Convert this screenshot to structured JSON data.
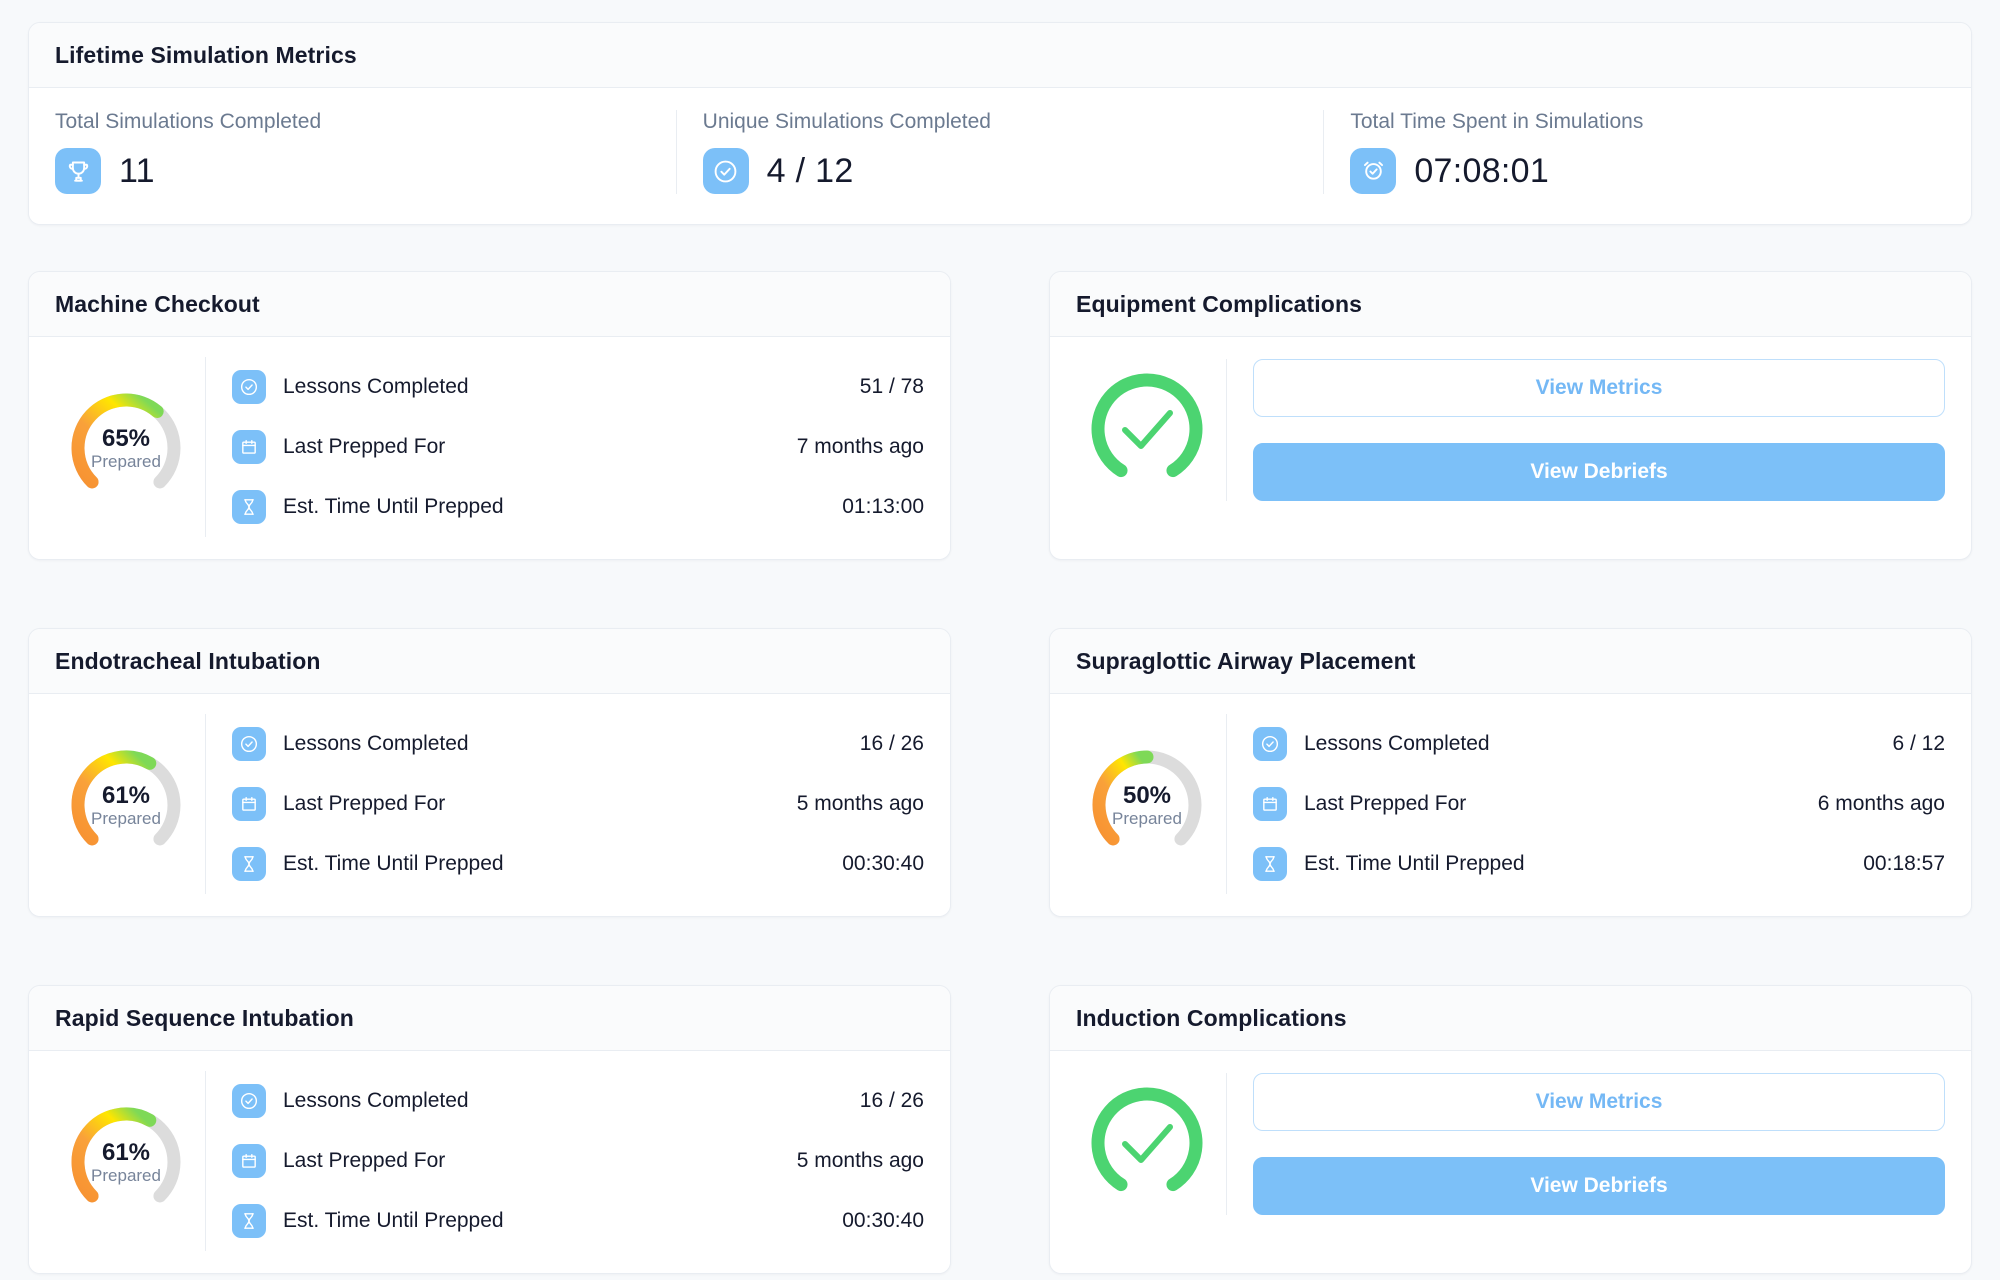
{
  "lifetime": {
    "title": "Lifetime Simulation Metrics",
    "metrics": [
      {
        "label": "Total Simulations Completed",
        "value": "11",
        "icon": "trophy-icon"
      },
      {
        "label": "Unique Simulations Completed",
        "value": "4 / 12",
        "icon": "check-circle-icon"
      },
      {
        "label": "Total Time Spent in Simulations",
        "value": "07:08:01",
        "icon": "alarm-check-icon"
      }
    ]
  },
  "colors": {
    "accent_blue": "#7cc0f8",
    "outline_blue": "#74b8f5",
    "complete_green": "#4cd471",
    "gauge_track": "#dcdcdc",
    "gauge_start": "#f79232",
    "gauge_mid": "#ffe600",
    "gauge_end": "#7ed957",
    "page_bg": "#f7f9fb",
    "card_header_bg": "#fafbfc",
    "text_dark": "#151a2d",
    "text_muted": "#6b7a90"
  },
  "cards": [
    {
      "kind": "gauge",
      "title": "Machine Checkout",
      "gauge": {
        "percent": 65,
        "pct_label": "65%",
        "sub_label": "Prepared"
      },
      "rows": [
        {
          "icon": "check-circle-icon",
          "label": "Lessons Completed",
          "value": "51 / 78"
        },
        {
          "icon": "calendar-icon",
          "label": "Last Prepped For",
          "value": "7 months ago"
        },
        {
          "icon": "hourglass-icon",
          "label": "Est. Time Until Prepped",
          "value": "01:13:00"
        }
      ]
    },
    {
      "kind": "complete",
      "title": "Equipment Complications",
      "gauge": {
        "icon": "check-gauge-icon"
      },
      "buttons": [
        {
          "label": "View Metrics",
          "style": "outline"
        },
        {
          "label": "View Debriefs",
          "style": "filled"
        }
      ]
    },
    {
      "kind": "gauge",
      "title": "Endotracheal Intubation",
      "gauge": {
        "percent": 61,
        "pct_label": "61%",
        "sub_label": "Prepared"
      },
      "rows": [
        {
          "icon": "check-circle-icon",
          "label": "Lessons Completed",
          "value": "16 / 26"
        },
        {
          "icon": "calendar-icon",
          "label": "Last Prepped For",
          "value": "5 months ago"
        },
        {
          "icon": "hourglass-icon",
          "label": "Est. Time Until Prepped",
          "value": "00:30:40"
        }
      ]
    },
    {
      "kind": "gauge",
      "title": "Supraglottic Airway Placement",
      "gauge": {
        "percent": 50,
        "pct_label": "50%",
        "sub_label": "Prepared"
      },
      "rows": [
        {
          "icon": "check-circle-icon",
          "label": "Lessons Completed",
          "value": "6 / 12"
        },
        {
          "icon": "calendar-icon",
          "label": "Last Prepped For",
          "value": "6 months ago"
        },
        {
          "icon": "hourglass-icon",
          "label": "Est. Time Until Prepped",
          "value": "00:18:57"
        }
      ]
    },
    {
      "kind": "gauge",
      "title": "Rapid Sequence Intubation",
      "gauge": {
        "percent": 61,
        "pct_label": "61%",
        "sub_label": "Prepared"
      },
      "rows": [
        {
          "icon": "check-circle-icon",
          "label": "Lessons Completed",
          "value": "16 / 26"
        },
        {
          "icon": "calendar-icon",
          "label": "Last Prepped For",
          "value": "5 months ago"
        },
        {
          "icon": "hourglass-icon",
          "label": "Est. Time Until Prepped",
          "value": "00:30:40"
        }
      ]
    },
    {
      "kind": "complete",
      "title": "Induction Complications",
      "gauge": {
        "icon": "check-gauge-icon"
      },
      "buttons": [
        {
          "label": "View Metrics",
          "style": "outline"
        },
        {
          "label": "View Debriefs",
          "style": "filled"
        }
      ]
    }
  ]
}
